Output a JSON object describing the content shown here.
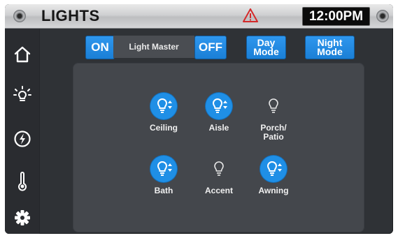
{
  "header": {
    "title": "LIGHTS",
    "time": "12:00PM",
    "warning_icon": "warning-triangle-icon",
    "warning_color": "#d42a2a"
  },
  "sidebar": {
    "items": [
      {
        "name": "home",
        "icon": "home-icon"
      },
      {
        "name": "lights",
        "icon": "lightbulb-icon"
      },
      {
        "name": "power",
        "icon": "power-icon"
      },
      {
        "name": "temperature",
        "icon": "thermometer-icon"
      },
      {
        "name": "settings",
        "icon": "gear-icon"
      }
    ]
  },
  "controls": {
    "on_label": "ON",
    "master_label": "Light Master",
    "off_label": "OFF",
    "day_line1": "Day",
    "day_line2": "Mode",
    "night_line1": "Night",
    "night_line2": "Mode",
    "accent_color": "#1f8fe6"
  },
  "lights": [
    {
      "label": "Ceiling",
      "state": "on"
    },
    {
      "label": "Aisle",
      "state": "on"
    },
    {
      "label_line1": "Porch/",
      "label_line2": "Patio",
      "state": "off"
    },
    {
      "label": "Bath",
      "state": "on"
    },
    {
      "label": "Accent",
      "state": "off"
    },
    {
      "label": "Awning",
      "state": "on"
    }
  ]
}
